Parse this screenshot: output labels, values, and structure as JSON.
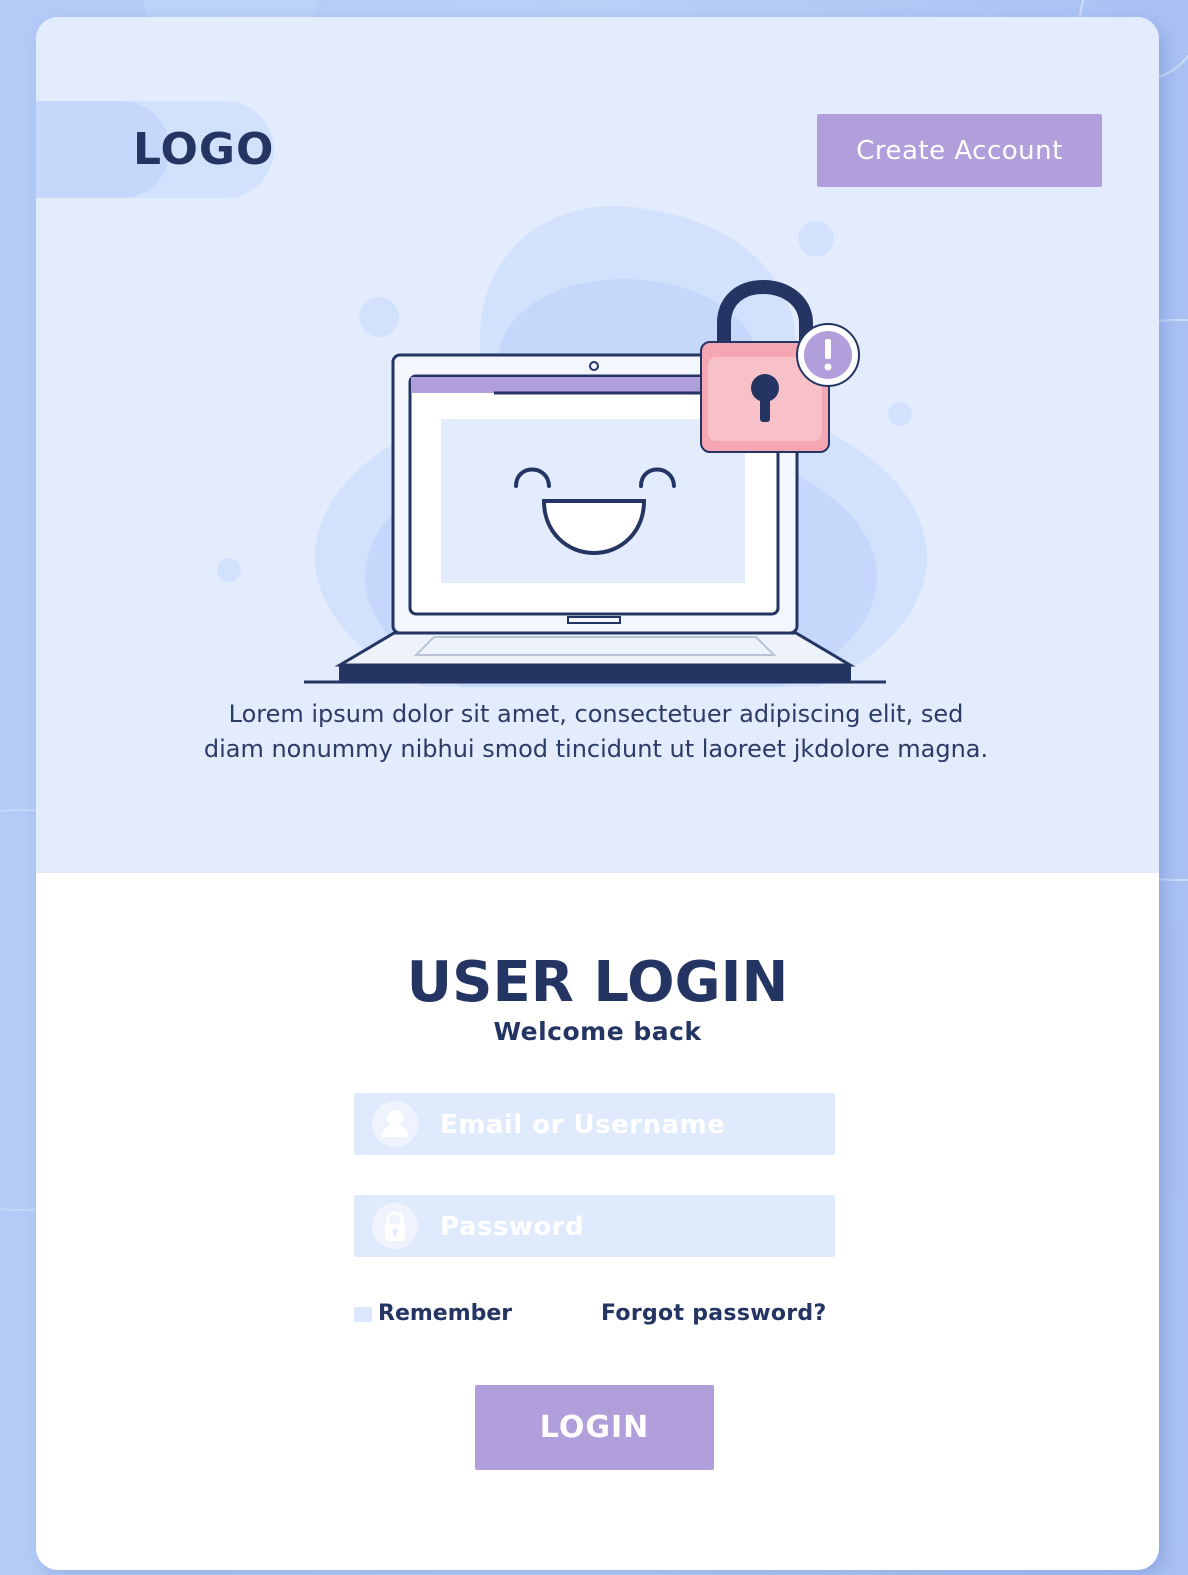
{
  "header": {
    "logo_text": "LOGO",
    "create_account_label": "Create Account"
  },
  "hero": {
    "description": "Lorem ipsum dolor sit amet, consectetuer adipiscing elit, sed diam nonummy nibhui smod tincidunt ut laoreet jkdolore magna."
  },
  "login": {
    "title": "USER LOGIN",
    "subtitle": "Welcome back",
    "email_placeholder": "Email or Username",
    "email_value": "",
    "password_placeholder": "Password",
    "password_value": "",
    "remember_label": "Remember",
    "forgot_label": "Forgot password?",
    "submit_label": "LOGIN"
  },
  "icons": {
    "user": "user-icon",
    "lock": "lock-icon",
    "padlock_alert": "padlock-alert-icon",
    "laptop": "laptop-illustration"
  },
  "colors": {
    "accent": "#b19fdb",
    "navy": "#243563",
    "hero_bg": "#e2ecfd",
    "field_bg": "#e0eafd",
    "lock_pink": "#f7b7c0"
  }
}
